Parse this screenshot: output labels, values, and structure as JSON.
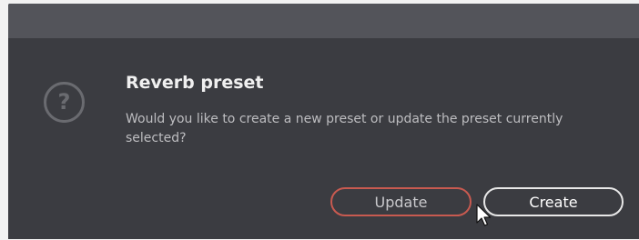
{
  "dialog": {
    "title": "Reverb preset",
    "message": "Would you like to create a new preset or update the preset currently selected?",
    "icon": "question-circle-icon",
    "buttons": {
      "update_label": "Update",
      "create_label": "Create"
    }
  },
  "colors": {
    "dialog_background": "#3b3c41",
    "titlebar_background": "#53545a",
    "update_border": "#c85a50",
    "create_border": "#e8e8e8"
  }
}
